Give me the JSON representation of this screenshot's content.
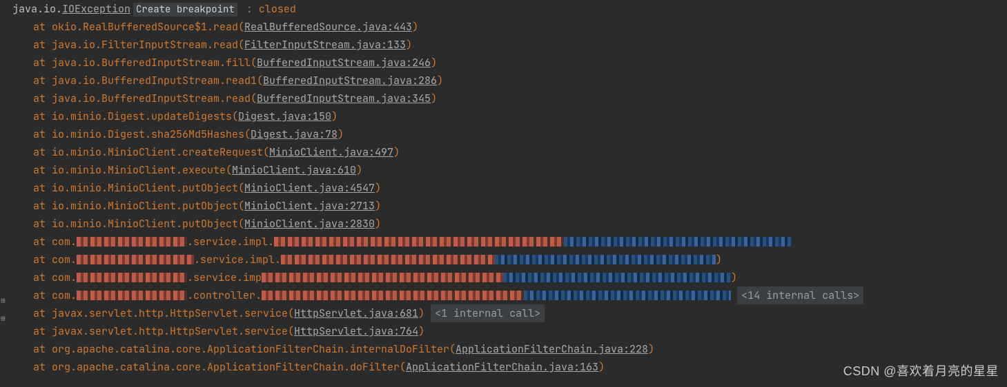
{
  "exception": {
    "pkg": "java.io.",
    "cls": "IOException",
    "hint": "Create breakpoint",
    "sep": " : ",
    "msg": "closed"
  },
  "at": "at ",
  "internal14": "<14 internal calls>",
  "internal1": "<1 internal call>",
  "frames": [
    {
      "path": "okio.RealBufferedSource$1.read",
      "link": "RealBufferedSource.java:443"
    },
    {
      "path": "java.io.FilterInputStream.read",
      "link": "FilterInputStream.java:133"
    },
    {
      "path": "java.io.BufferedInputStream.fill",
      "link": "BufferedInputStream.java:246"
    },
    {
      "path": "java.io.BufferedInputStream.read1",
      "link": "BufferedInputStream.java:286"
    },
    {
      "path": "java.io.BufferedInputStream.read",
      "link": "BufferedInputStream.java:345"
    },
    {
      "path": "io.minio.Digest.updateDigests",
      "link": "Digest.java:150"
    },
    {
      "path": "io.minio.Digest.sha256Md5Hashes",
      "link": "Digest.java:78"
    },
    {
      "path": "io.minio.MinioClient.createRequest",
      "link": "MinioClient.java:497"
    },
    {
      "path": "io.minio.MinioClient.execute",
      "link": "MinioClient.java:610"
    },
    {
      "path": "io.minio.MinioClient.putObject",
      "link": "MinioClient.java:4547"
    },
    {
      "path": "io.minio.MinioClient.putObject",
      "link": "MinioClient.java:2713"
    },
    {
      "path": "io.minio.MinioClient.putObject",
      "link": "MinioClient.java:2830"
    },
    {
      "obf": true,
      "pre": "com.",
      "svc": ".service.impl.",
      "redA": 160,
      "redB": 420,
      "blueA": 330,
      "tail": ""
    },
    {
      "obf": true,
      "pre": "com.",
      "svc": ".service.impl.",
      "redA": 170,
      "redB": 310,
      "blueA": 320,
      "tail": ")"
    },
    {
      "obf": true,
      "pre": "com.",
      "svc": ".service.imp",
      "redA": 160,
      "redB": 350,
      "blueA": 330,
      "tail": ")"
    },
    {
      "obf": true,
      "pre": "com.",
      "svc": ".controller.",
      "redA": 160,
      "redB": 380,
      "blueA": 300,
      "tail": "",
      "internal": "internal14"
    },
    {
      "path": "javax.servlet.http.HttpServlet.service",
      "link": "HttpServlet.java:681",
      "internal": "internal1"
    },
    {
      "path": "javax.servlet.http.HttpServlet.service",
      "link": "HttpServlet.java:764"
    },
    {
      "path": "org.apache.catalina.core.ApplicationFilterChain.internalDoFilter",
      "link": "ApplicationFilterChain.java:228"
    },
    {
      "path": "org.apache.catalina.core.ApplicationFilterChain.doFilter",
      "link": "ApplicationFilterChain.java:163"
    }
  ],
  "gutters": [
    {
      "row": 16
    },
    {
      "row": 17
    }
  ],
  "watermark": "CSDN @喜欢着月亮的星星"
}
